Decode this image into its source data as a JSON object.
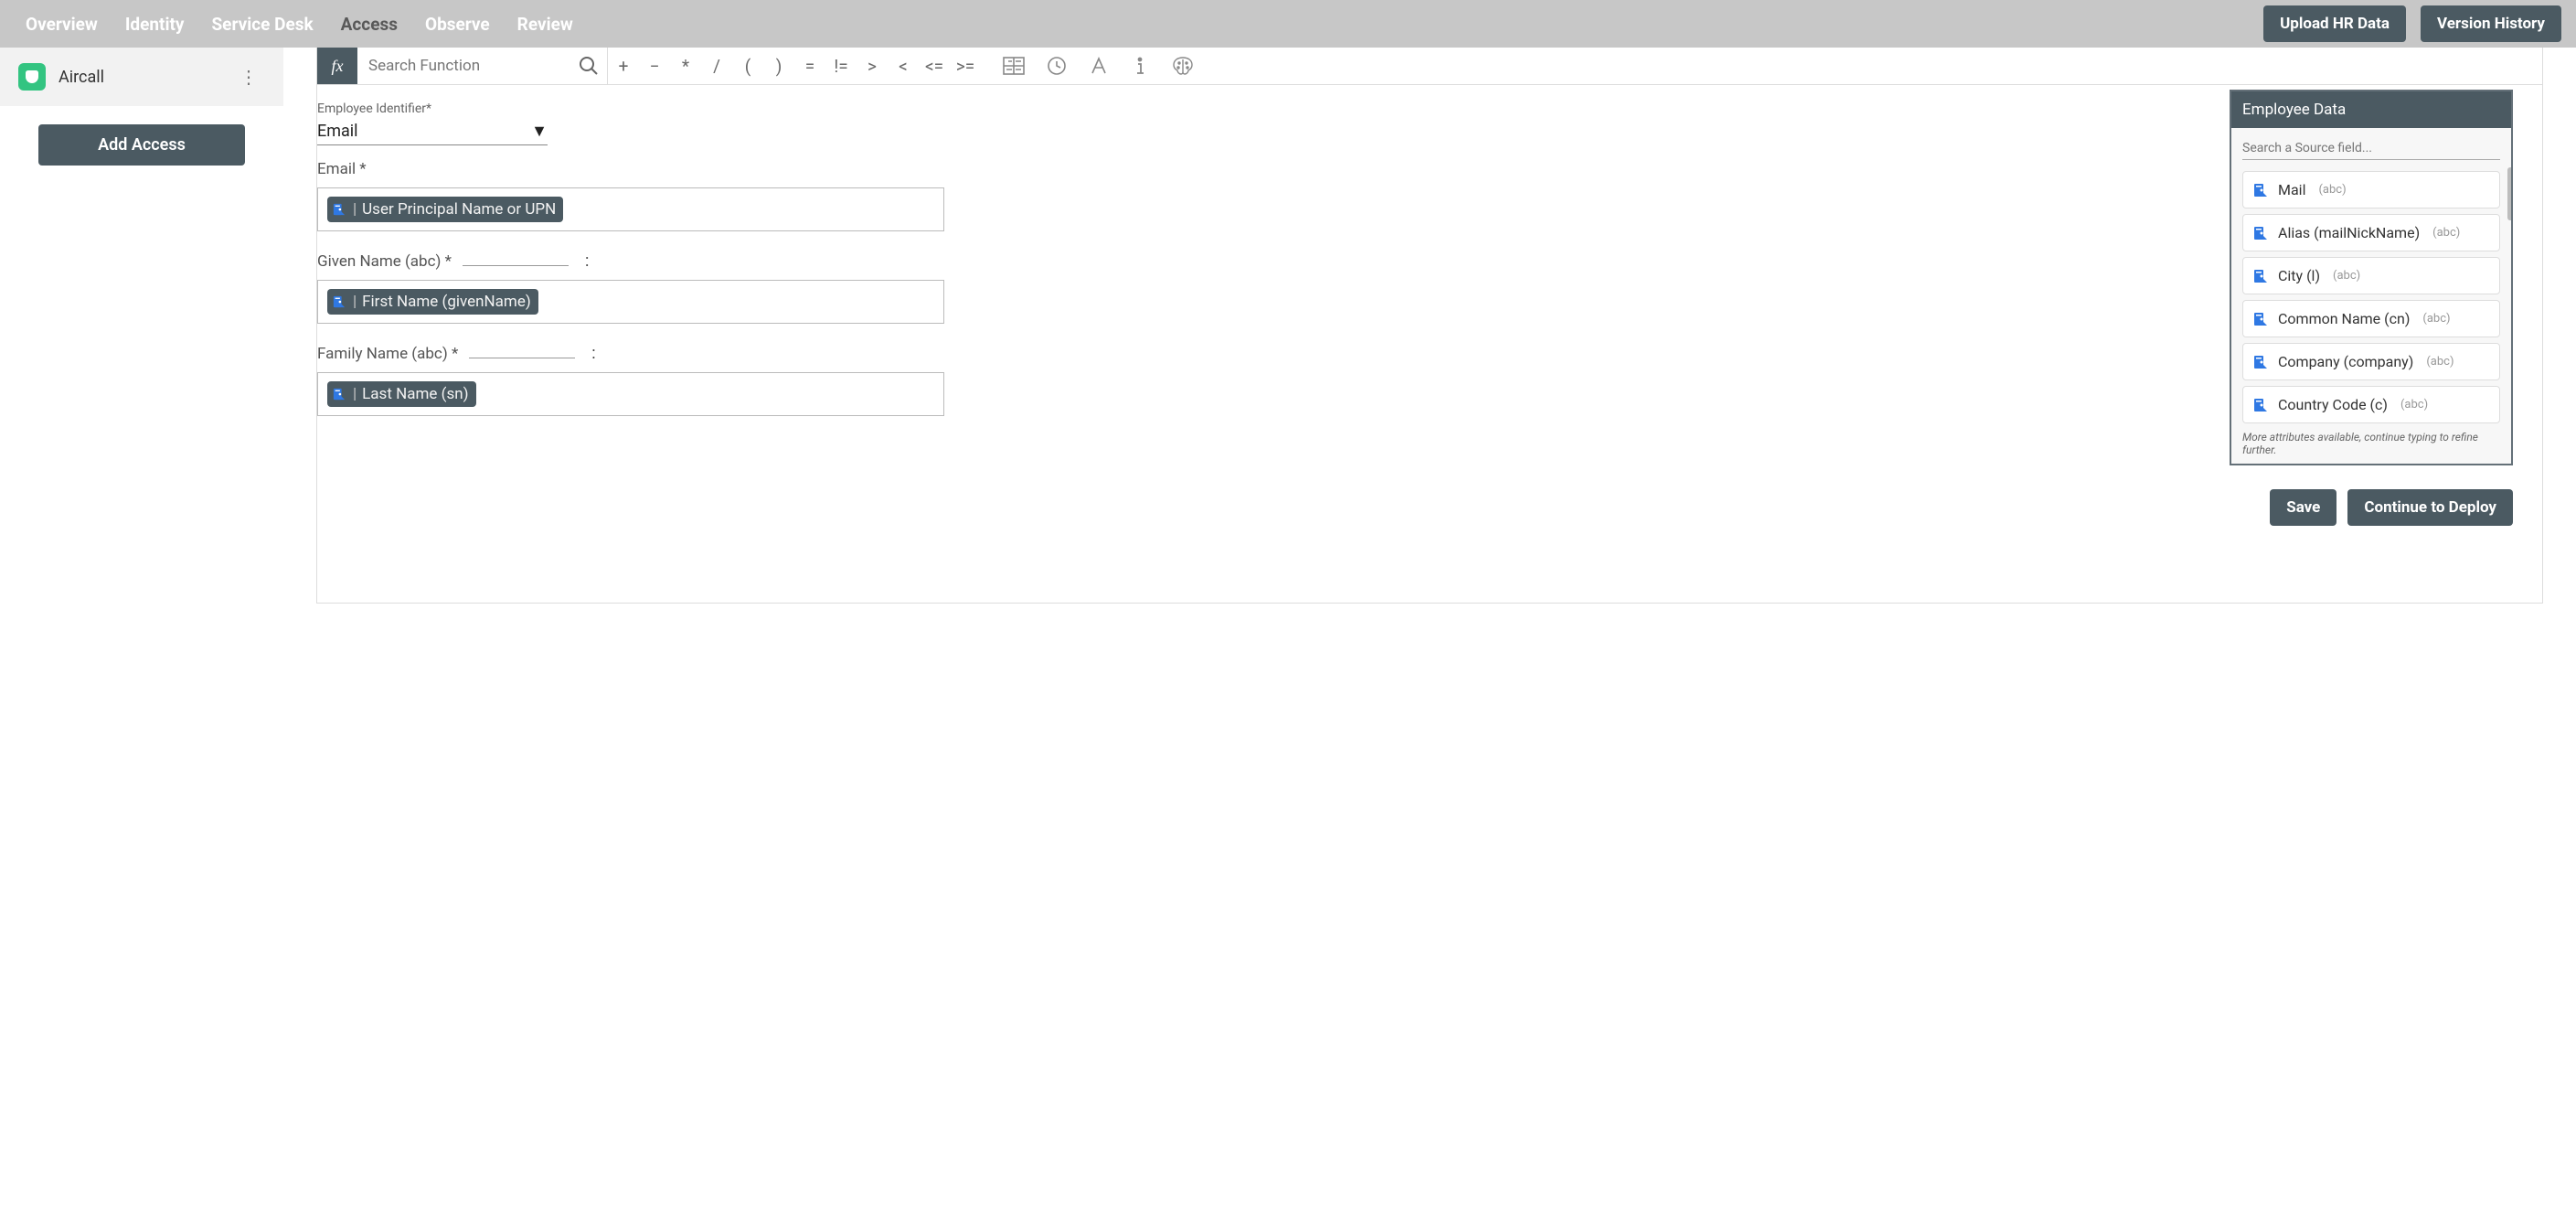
{
  "nav": {
    "tabs": [
      "Overview",
      "Identity",
      "Service Desk",
      "Access",
      "Observe",
      "Review"
    ],
    "active": "Access",
    "upload": "Upload HR Data",
    "version": "Version History"
  },
  "sidebar": {
    "app_name": "Aircall",
    "add_access": "Add Access"
  },
  "formula": {
    "fx": "fx",
    "search_placeholder": "Search Function",
    "ops": [
      "+",
      "−",
      "*",
      "/",
      "(",
      ")",
      "=",
      "!=",
      ">",
      "<",
      "<=",
      ">="
    ]
  },
  "form": {
    "emp_id_label": "Employee Identifier*",
    "emp_id_value": "Email",
    "email_label": "Email *",
    "email_token": "User Principal Name or UPN",
    "given_label": "Given Name (abc) *",
    "given_token": "First Name (givenName)",
    "family_label": "Family Name (abc) *",
    "family_token": "Last Name (sn)",
    "colon": ":"
  },
  "emp": {
    "title": "Employee Data",
    "search_placeholder": "Search a Source field...",
    "items": [
      {
        "name": "Mail",
        "type": "(abc)"
      },
      {
        "name": "Alias (mailNickName)",
        "type": "(abc)"
      },
      {
        "name": "City (l)",
        "type": "(abc)"
      },
      {
        "name": "Common Name (cn)",
        "type": "(abc)"
      },
      {
        "name": "Company (company)",
        "type": "(abc)"
      },
      {
        "name": "Country Code (c)",
        "type": "(abc)"
      }
    ],
    "more": "More attributes available, continue typing to refine further."
  },
  "actions": {
    "save": "Save",
    "deploy": "Continue to Deploy"
  }
}
